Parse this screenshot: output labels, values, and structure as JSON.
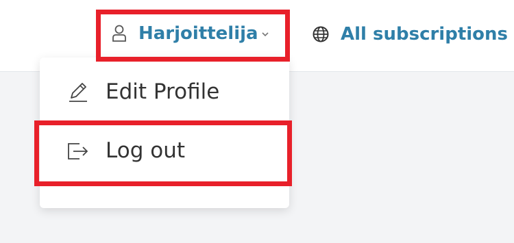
{
  "header": {
    "user_menu_label": "Harjoittelija",
    "user_icon": "user-icon",
    "chevron_icon": "chevron-down-icon",
    "subscriptions_label": "All subscriptions",
    "subscriptions_icon": "globe-icon"
  },
  "dropdown": {
    "items": [
      {
        "label": "Edit Profile",
        "icon": "pencil-icon"
      },
      {
        "label": "Log out",
        "icon": "logout-icon"
      }
    ]
  },
  "colors": {
    "link": "#2f7fa8",
    "highlight": "#e8202a",
    "text": "#333333"
  }
}
